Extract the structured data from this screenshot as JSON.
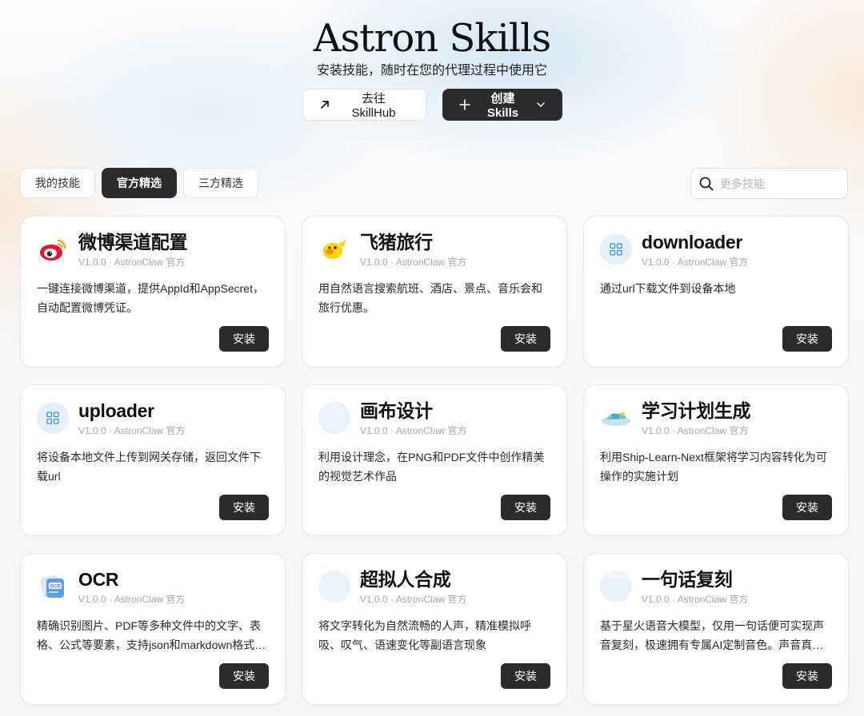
{
  "hero": {
    "title": "Astron Skills",
    "subtitle": "安装技能，随时在您的代理过程中使用它",
    "skillhub_label": "去往 SkillHub",
    "create_label": "创建 Skills"
  },
  "tabs": [
    {
      "label": "我的技能",
      "active": false
    },
    {
      "label": "官方精选",
      "active": true
    },
    {
      "label": "三方精选",
      "active": false
    }
  ],
  "search": {
    "placeholder": "更多技能"
  },
  "cards": [
    {
      "title": "微博渠道配置",
      "meta": "V1.0.0 · AstronClaw 官方",
      "desc": "一键连接微博渠道，提供AppId和AppSecret，自动配置微博凭证。",
      "install": "安装",
      "icon": "weibo-icon"
    },
    {
      "title": "飞猪旅行",
      "meta": "V1.0.0 · AstronClaw 官方",
      "desc": "用自然语言搜索航班、酒店、景点、音乐会和旅行优惠。",
      "install": "安装",
      "icon": "fliggy-icon"
    },
    {
      "title": "downloader",
      "meta": "V1.0.0 · AstronClaw 官方",
      "desc": "通过url下载文件到设备本地",
      "install": "安装",
      "icon": "grid-icon"
    },
    {
      "title": "uploader",
      "meta": "V1.0.0 · AstronClaw 官方",
      "desc": "将设备本地文件上传到网关存储，返回文件下载url",
      "install": "安装",
      "icon": "grid-icon"
    },
    {
      "title": "画布设计",
      "meta": "V1.0.0 · AstronClaw 官方",
      "desc": "利用设计理念，在PNG和PDF文件中创作精美的视觉艺术作品",
      "install": "安装",
      "icon": "canvas-icon"
    },
    {
      "title": "学习计划生成",
      "meta": "V1.0.0 · AstronClaw 官方",
      "desc": "利用Ship-Learn-Next框架将学习内容转化为可操作的实施计划",
      "install": "安装",
      "icon": "island-icon"
    },
    {
      "title": "OCR",
      "meta": "V1.0.0 · AstronClaw 官方",
      "desc": "精确识别图片、PDF等多种文件中的文字、表格、公式等要素，支持json和markdown格式输出",
      "install": "安装",
      "icon": "ocr-icon"
    },
    {
      "title": "超拟人合成",
      "meta": "V1.0.0 · AstronClaw 官方",
      "desc": "将文字转化为自然流畅的人声，精准模拟呼吸、叹气、语速变化等副语言现象",
      "install": "安装",
      "icon": "voice-icon"
    },
    {
      "title": "一句话复刻",
      "meta": "V1.0.0 · AstronClaw 官方",
      "desc": "基于星火语音大模型，仅用一句话便可实现声音复刻，极速拥有专属AI定制音色。声音真实自然",
      "install": "安装",
      "icon": "voice-clone-icon"
    }
  ]
}
